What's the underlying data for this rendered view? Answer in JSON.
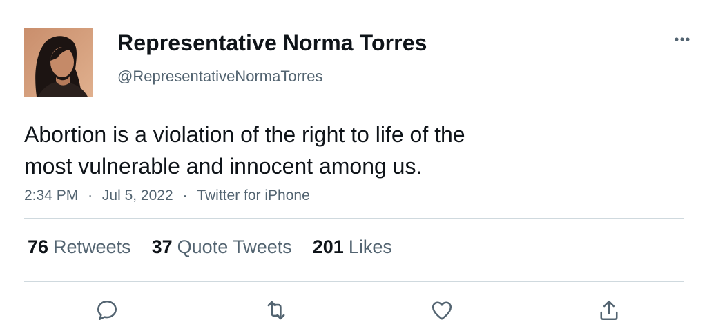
{
  "author": {
    "display_name": "Representative Norma Torres",
    "handle": "@RepresentativeNormaTorres",
    "avatar": "profile-photo"
  },
  "tweet": {
    "text_lines": [
      "Abortion is a violation of the right to life of the",
      "most vulnerable and innocent among us."
    ],
    "time": "2:34 PM",
    "date": "Jul 5, 2022",
    "source": "Twitter for iPhone",
    "separator": "·"
  },
  "stats": {
    "retweets": {
      "count": "76",
      "label": "Retweets"
    },
    "quote_tweets": {
      "count": "37",
      "label": "Quote Tweets"
    },
    "likes": {
      "count": "201",
      "label": "Likes"
    }
  },
  "actions": {
    "reply": "reply-icon",
    "retweet": "retweet-icon",
    "like": "heart-icon",
    "share": "share-icon",
    "more": "more-options-icon"
  },
  "colors": {
    "text": "#0f1419",
    "secondary": "#536471",
    "divider": "#cfd9de",
    "icon": "#536471"
  }
}
